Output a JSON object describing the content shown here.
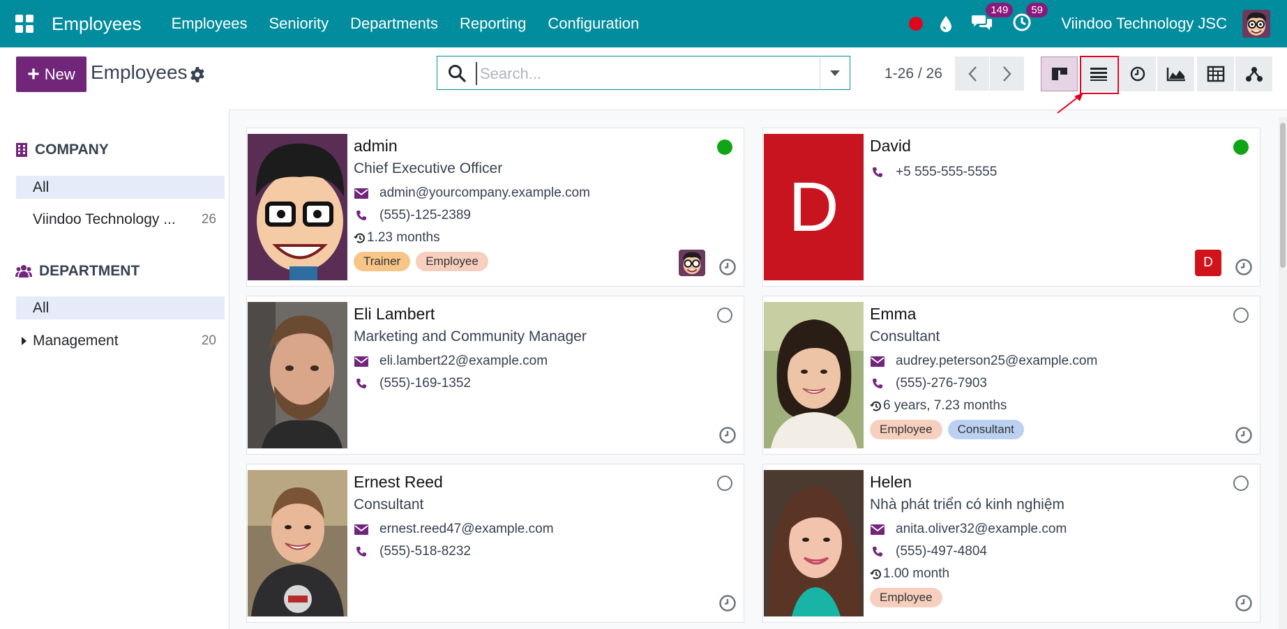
{
  "navbar": {
    "brand": "Employees",
    "menu": [
      "Employees",
      "Seniority",
      "Departments",
      "Reporting",
      "Configuration"
    ],
    "chat_count": "149",
    "activity_count": "59",
    "company": "Viindoo Technology JSC",
    "bg_color": "#018d9d"
  },
  "control": {
    "new_label": "New",
    "title": "Employees",
    "search_placeholder": "Search...",
    "pager": "1-26 / 26",
    "views": [
      "kanban",
      "list",
      "activity",
      "graph",
      "pivot",
      "hierarchy"
    ],
    "active_view": "kanban",
    "accent": "#71267a"
  },
  "sidebar": {
    "company_header": "COMPANY",
    "company_items": [
      {
        "label": "All",
        "count": ""
      },
      {
        "label": "Viindoo Technology ...",
        "count": "26"
      }
    ],
    "department_header": "DEPARTMENT",
    "department_items": [
      {
        "label": "All",
        "count": ""
      },
      {
        "label": "Management",
        "count": "20"
      }
    ]
  },
  "employees": [
    {
      "name": "admin",
      "job": "Chief Executive Officer",
      "email": "admin@yourcompany.example.com",
      "phone": "(555)-125-2389",
      "seniority": "1.23 months",
      "tags": [
        "Trainer",
        "Employee"
      ],
      "status": "online"
    },
    {
      "name": "David",
      "job": "",
      "email": "",
      "phone": "+5 555-555-5555",
      "seniority": "",
      "tags": [],
      "status": "online",
      "initial": "D"
    },
    {
      "name": "Eli Lambert",
      "job": "Marketing and Community Manager",
      "email": "eli.lambert22@example.com",
      "phone": "(555)-169-1352",
      "seniority": "",
      "tags": [],
      "status": "offline"
    },
    {
      "name": "Emma",
      "job": "Consultant",
      "email": "audrey.peterson25@example.com",
      "phone": "(555)-276-7903",
      "seniority": "6 years, 7.23 months",
      "tags": [
        "Employee",
        "Consultant"
      ],
      "status": "offline"
    },
    {
      "name": "Ernest Reed",
      "job": "Consultant",
      "email": "ernest.reed47@example.com",
      "phone": "(555)-518-8232",
      "seniority": "",
      "tags": [],
      "status": "offline"
    },
    {
      "name": "Helen",
      "job": "Nhà phát triển có kinh nghiệm",
      "email": "anita.oliver32@example.com",
      "phone": "(555)-497-4804",
      "seniority": "1.00 month",
      "tags": [
        "Employee"
      ],
      "status": "offline"
    }
  ]
}
